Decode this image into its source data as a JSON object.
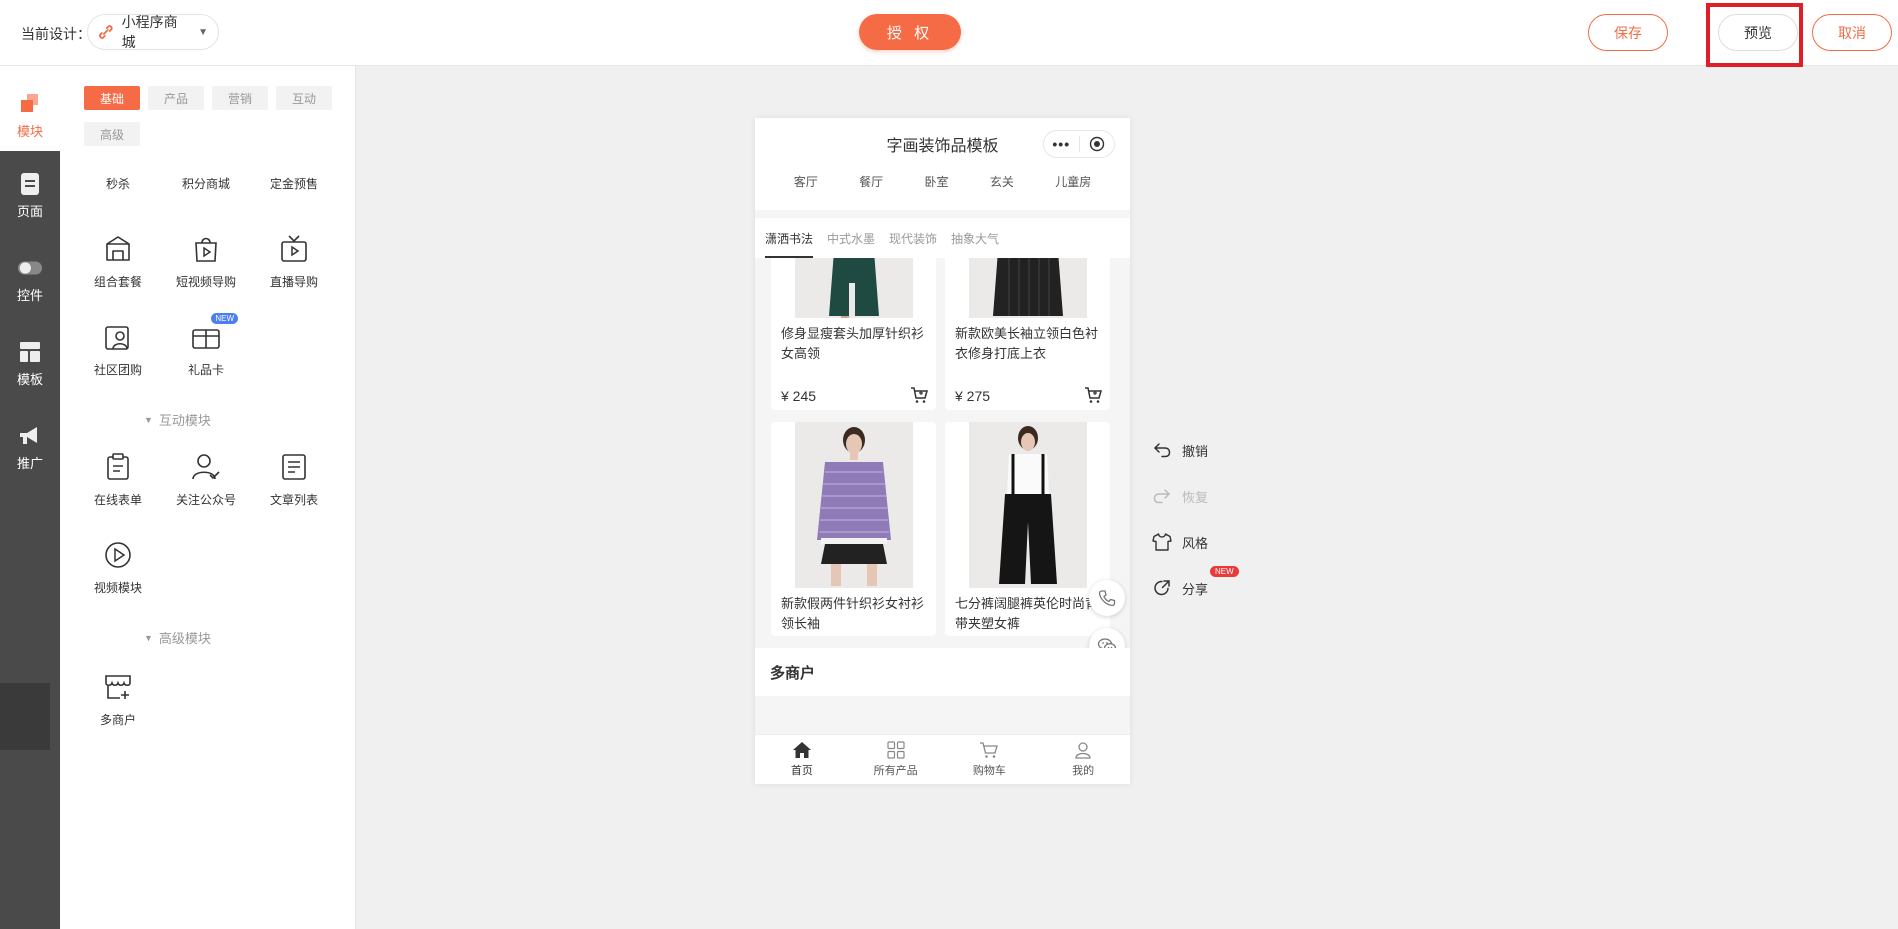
{
  "topbar": {
    "current_design_label": "当前设计：",
    "design_name": "小程序商城",
    "auth_label": "授 权",
    "save_label": "保存",
    "preview_label": "预览",
    "cancel_label": "取消"
  },
  "rail": {
    "items": [
      {
        "label": "模块",
        "icon": "module-icon"
      },
      {
        "label": "页面",
        "icon": "page-icon"
      },
      {
        "label": "控件",
        "icon": "toggle-icon"
      },
      {
        "label": "模板",
        "icon": "template-icon"
      },
      {
        "label": "推广",
        "icon": "megaphone-icon"
      }
    ]
  },
  "panel": {
    "categories": [
      "基础",
      "产品",
      "营销",
      "互动",
      "高级"
    ],
    "row1": [
      "秒杀",
      "积分商城",
      "定金预售"
    ],
    "row2": [
      "组合套餐",
      "短视频导购",
      "直播导购"
    ],
    "row3": [
      "社区团购",
      "礼品卡"
    ],
    "new_badge": "NEW",
    "section_interact": "互动模块",
    "row4": [
      "在线表单",
      "关注公众号",
      "文章列表"
    ],
    "row5": [
      "视频模块"
    ],
    "section_advanced": "高级模块",
    "row6": [
      "多商户"
    ]
  },
  "phone": {
    "title": "字画装饰品模板",
    "cat_nav": [
      "客厅",
      "餐厅",
      "卧室",
      "玄关",
      "儿童房"
    ],
    "tabs": [
      "潇洒书法",
      "中式水墨",
      "现代装饰",
      "抽象大气"
    ],
    "products": [
      {
        "name": "修身显瘦套头加厚针织衫女高领",
        "price": "¥ 245"
      },
      {
        "name": "新款欧美长袖立领白色衬衣修身打底上衣",
        "price": "¥ 275"
      },
      {
        "name": "新款假两件针织衫女衬衫领长袖",
        "price": ""
      },
      {
        "name": "七分裤阔腿裤英伦时尚背带夹塑女裤",
        "price": ""
      }
    ],
    "merchant_title": "多商户",
    "tabbar": [
      "首页",
      "所有产品",
      "购物车",
      "我的"
    ]
  },
  "tools": {
    "undo": "撤销",
    "redo": "恢复",
    "style": "风格",
    "share": "分享",
    "new_badge": "NEW"
  },
  "colors": {
    "accent": "#f46b45",
    "highlight": "#e01e26",
    "rail": "#4a4a4a"
  }
}
